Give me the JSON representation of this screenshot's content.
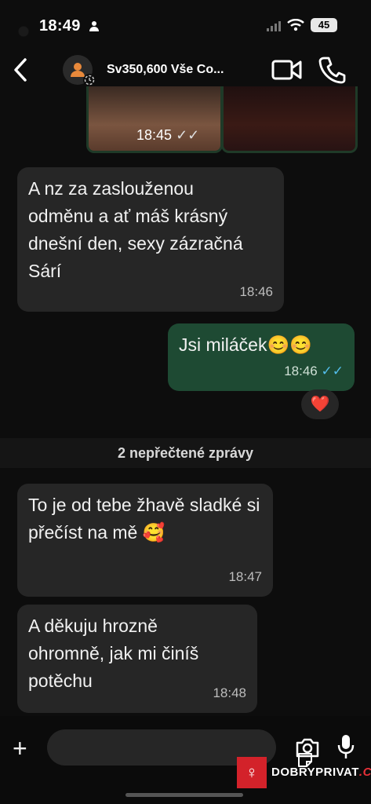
{
  "status_bar": {
    "time": "18:49",
    "battery": "45"
  },
  "header": {
    "title": "Sv350,600 Vše Co..."
  },
  "photos": {
    "time": "18:45"
  },
  "messages": [
    {
      "direction": "in",
      "text": "A nz za zaslouženou odměnu a ať máš krásný dnešní den, sexy zázračná Sárí",
      "time": "18:46"
    },
    {
      "direction": "out",
      "text": "Jsi miláček😊😊",
      "time": "18:46"
    },
    {
      "direction": "in",
      "text": "To je od tebe žhavě sladké si přečíst na mě 🥰",
      "time": "18:47"
    },
    {
      "direction": "in",
      "text": "A děkuju hrozně ohromně, jak mi činíš potěchu",
      "time": "18:48"
    }
  ],
  "reaction": "❤️",
  "unread_divider": "2 nepřečtené zprávy",
  "watermark": {
    "brand": "DOBRYPRIVAT",
    "tld": ".CZ"
  },
  "colors": {
    "incoming": "#262626",
    "outgoing": "#1e4a33",
    "read_ticks": "#53bdeb"
  }
}
